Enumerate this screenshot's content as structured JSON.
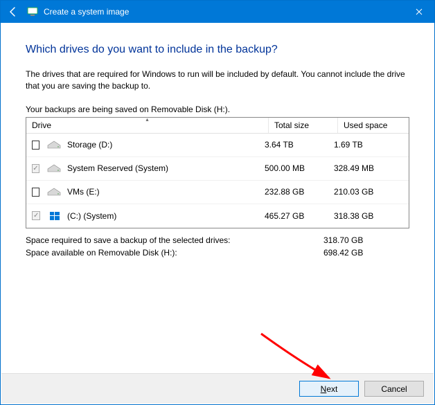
{
  "titlebar": {
    "title": "Create a system image"
  },
  "heading": "Which drives do you want to include in the backup?",
  "description": "The drives that are required for Windows to run will be included by default. You cannot include the drive that you are saving the backup to.",
  "save_target_line": "Your backups are being saved on Removable Disk (H:).",
  "columns": {
    "drive": "Drive",
    "total": "Total size",
    "used": "Used space"
  },
  "drives": [
    {
      "name": "Storage (D:)",
      "total": "3.64 TB",
      "used": "1.69 TB",
      "checked": false,
      "required": false,
      "icon": "hdd"
    },
    {
      "name": "System Reserved (System)",
      "total": "500.00 MB",
      "used": "328.49 MB",
      "checked": true,
      "required": true,
      "icon": "hdd"
    },
    {
      "name": "VMs (E:)",
      "total": "232.88 GB",
      "used": "210.03 GB",
      "checked": false,
      "required": false,
      "icon": "hdd"
    },
    {
      "name": "(C:) (System)",
      "total": "465.27 GB",
      "used": "318.38 GB",
      "checked": true,
      "required": true,
      "icon": "win"
    }
  ],
  "summary": {
    "required_label": "Space required to save a backup of the selected drives:",
    "required_value": "318.70 GB",
    "available_label": "Space available on Removable Disk (H:):",
    "available_value": "698.42 GB"
  },
  "buttons": {
    "next": "Next",
    "cancel": "Cancel"
  }
}
